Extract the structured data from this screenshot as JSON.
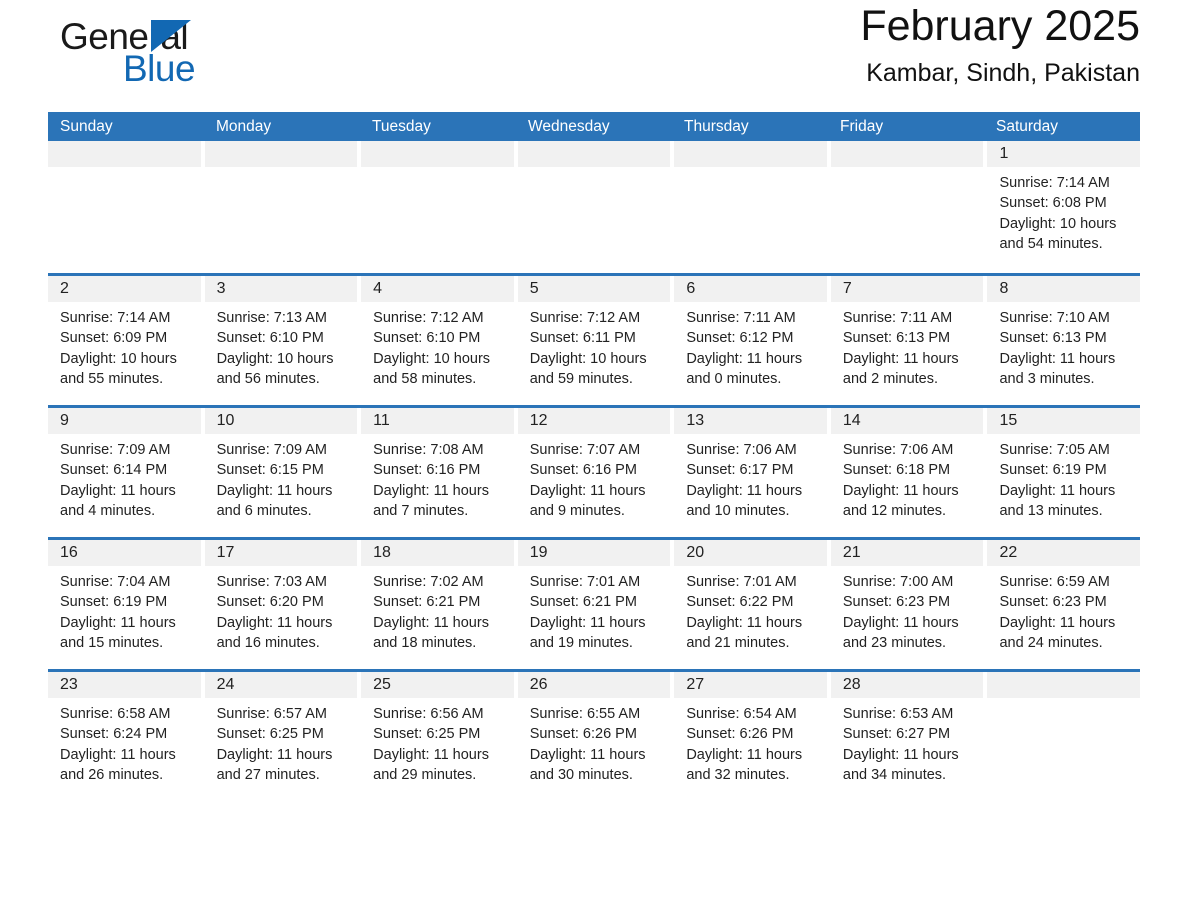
{
  "logo": {
    "word_black": "General",
    "word_blue": "Blue",
    "triangle_icon": "triangle-icon",
    "brand_color": "#1268b3"
  },
  "header": {
    "month_title": "February 2025",
    "location": "Kambar, Sindh, Pakistan"
  },
  "colors": {
    "header_blue": "#2b74b8",
    "row_rule": "#2b74b8",
    "day_band": "#f1f1f1",
    "text": "#222222"
  },
  "calendar": {
    "weekdays": [
      "Sunday",
      "Monday",
      "Tuesday",
      "Wednesday",
      "Thursday",
      "Friday",
      "Saturday"
    ],
    "weeks": [
      [
        {
          "day": "",
          "sunrise": "",
          "sunset": "",
          "daylight": ""
        },
        {
          "day": "",
          "sunrise": "",
          "sunset": "",
          "daylight": ""
        },
        {
          "day": "",
          "sunrise": "",
          "sunset": "",
          "daylight": ""
        },
        {
          "day": "",
          "sunrise": "",
          "sunset": "",
          "daylight": ""
        },
        {
          "day": "",
          "sunrise": "",
          "sunset": "",
          "daylight": ""
        },
        {
          "day": "",
          "sunrise": "",
          "sunset": "",
          "daylight": ""
        },
        {
          "day": "1",
          "sunrise": "Sunrise: 7:14 AM",
          "sunset": "Sunset: 6:08 PM",
          "daylight": "Daylight: 10 hours and 54 minutes."
        }
      ],
      [
        {
          "day": "2",
          "sunrise": "Sunrise: 7:14 AM",
          "sunset": "Sunset: 6:09 PM",
          "daylight": "Daylight: 10 hours and 55 minutes."
        },
        {
          "day": "3",
          "sunrise": "Sunrise: 7:13 AM",
          "sunset": "Sunset: 6:10 PM",
          "daylight": "Daylight: 10 hours and 56 minutes."
        },
        {
          "day": "4",
          "sunrise": "Sunrise: 7:12 AM",
          "sunset": "Sunset: 6:10 PM",
          "daylight": "Daylight: 10 hours and 58 minutes."
        },
        {
          "day": "5",
          "sunrise": "Sunrise: 7:12 AM",
          "sunset": "Sunset: 6:11 PM",
          "daylight": "Daylight: 10 hours and 59 minutes."
        },
        {
          "day": "6",
          "sunrise": "Sunrise: 7:11 AM",
          "sunset": "Sunset: 6:12 PM",
          "daylight": "Daylight: 11 hours and 0 minutes."
        },
        {
          "day": "7",
          "sunrise": "Sunrise: 7:11 AM",
          "sunset": "Sunset: 6:13 PM",
          "daylight": "Daylight: 11 hours and 2 minutes."
        },
        {
          "day": "8",
          "sunrise": "Sunrise: 7:10 AM",
          "sunset": "Sunset: 6:13 PM",
          "daylight": "Daylight: 11 hours and 3 minutes."
        }
      ],
      [
        {
          "day": "9",
          "sunrise": "Sunrise: 7:09 AM",
          "sunset": "Sunset: 6:14 PM",
          "daylight": "Daylight: 11 hours and 4 minutes."
        },
        {
          "day": "10",
          "sunrise": "Sunrise: 7:09 AM",
          "sunset": "Sunset: 6:15 PM",
          "daylight": "Daylight: 11 hours and 6 minutes."
        },
        {
          "day": "11",
          "sunrise": "Sunrise: 7:08 AM",
          "sunset": "Sunset: 6:16 PM",
          "daylight": "Daylight: 11 hours and 7 minutes."
        },
        {
          "day": "12",
          "sunrise": "Sunrise: 7:07 AM",
          "sunset": "Sunset: 6:16 PM",
          "daylight": "Daylight: 11 hours and 9 minutes."
        },
        {
          "day": "13",
          "sunrise": "Sunrise: 7:06 AM",
          "sunset": "Sunset: 6:17 PM",
          "daylight": "Daylight: 11 hours and 10 minutes."
        },
        {
          "day": "14",
          "sunrise": "Sunrise: 7:06 AM",
          "sunset": "Sunset: 6:18 PM",
          "daylight": "Daylight: 11 hours and 12 minutes."
        },
        {
          "day": "15",
          "sunrise": "Sunrise: 7:05 AM",
          "sunset": "Sunset: 6:19 PM",
          "daylight": "Daylight: 11 hours and 13 minutes."
        }
      ],
      [
        {
          "day": "16",
          "sunrise": "Sunrise: 7:04 AM",
          "sunset": "Sunset: 6:19 PM",
          "daylight": "Daylight: 11 hours and 15 minutes."
        },
        {
          "day": "17",
          "sunrise": "Sunrise: 7:03 AM",
          "sunset": "Sunset: 6:20 PM",
          "daylight": "Daylight: 11 hours and 16 minutes."
        },
        {
          "day": "18",
          "sunrise": "Sunrise: 7:02 AM",
          "sunset": "Sunset: 6:21 PM",
          "daylight": "Daylight: 11 hours and 18 minutes."
        },
        {
          "day": "19",
          "sunrise": "Sunrise: 7:01 AM",
          "sunset": "Sunset: 6:21 PM",
          "daylight": "Daylight: 11 hours and 19 minutes."
        },
        {
          "day": "20",
          "sunrise": "Sunrise: 7:01 AM",
          "sunset": "Sunset: 6:22 PM",
          "daylight": "Daylight: 11 hours and 21 minutes."
        },
        {
          "day": "21",
          "sunrise": "Sunrise: 7:00 AM",
          "sunset": "Sunset: 6:23 PM",
          "daylight": "Daylight: 11 hours and 23 minutes."
        },
        {
          "day": "22",
          "sunrise": "Sunrise: 6:59 AM",
          "sunset": "Sunset: 6:23 PM",
          "daylight": "Daylight: 11 hours and 24 minutes."
        }
      ],
      [
        {
          "day": "23",
          "sunrise": "Sunrise: 6:58 AM",
          "sunset": "Sunset: 6:24 PM",
          "daylight": "Daylight: 11 hours and 26 minutes."
        },
        {
          "day": "24",
          "sunrise": "Sunrise: 6:57 AM",
          "sunset": "Sunset: 6:25 PM",
          "daylight": "Daylight: 11 hours and 27 minutes."
        },
        {
          "day": "25",
          "sunrise": "Sunrise: 6:56 AM",
          "sunset": "Sunset: 6:25 PM",
          "daylight": "Daylight: 11 hours and 29 minutes."
        },
        {
          "day": "26",
          "sunrise": "Sunrise: 6:55 AM",
          "sunset": "Sunset: 6:26 PM",
          "daylight": "Daylight: 11 hours and 30 minutes."
        },
        {
          "day": "27",
          "sunrise": "Sunrise: 6:54 AM",
          "sunset": "Sunset: 6:26 PM",
          "daylight": "Daylight: 11 hours and 32 minutes."
        },
        {
          "day": "28",
          "sunrise": "Sunrise: 6:53 AM",
          "sunset": "Sunset: 6:27 PM",
          "daylight": "Daylight: 11 hours and 34 minutes."
        },
        {
          "day": "",
          "sunrise": "",
          "sunset": "",
          "daylight": ""
        }
      ]
    ]
  }
}
